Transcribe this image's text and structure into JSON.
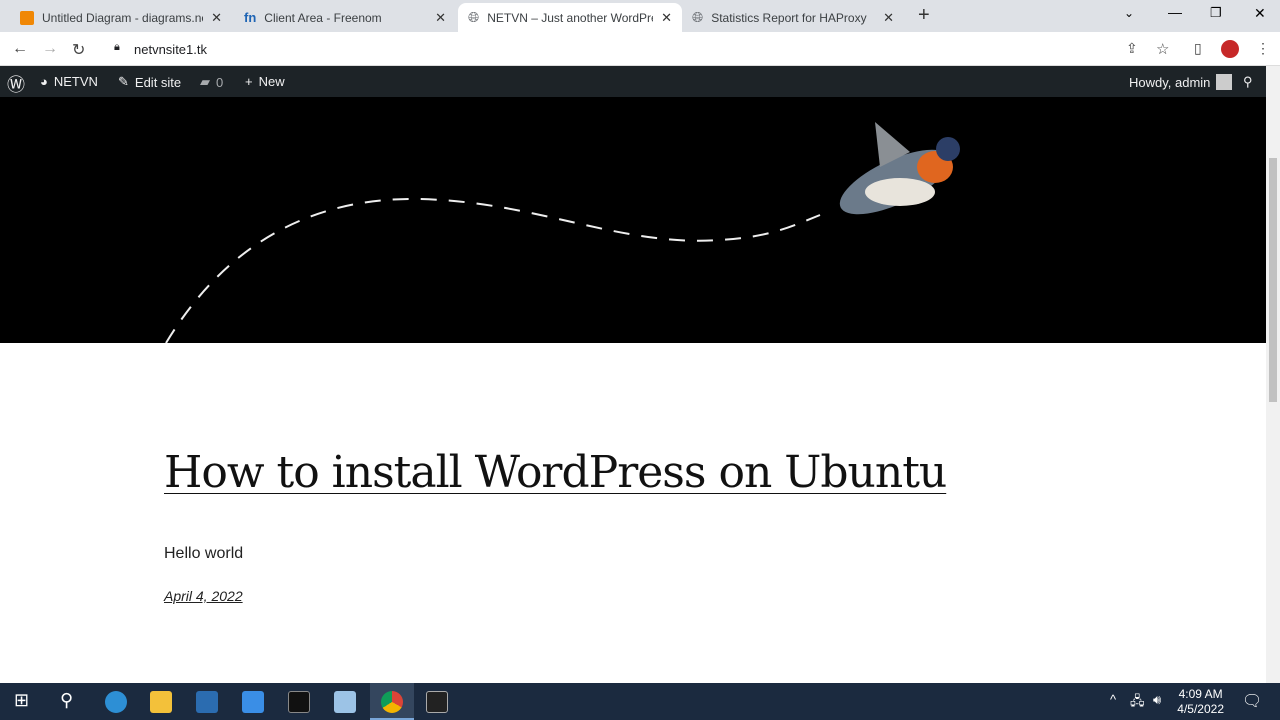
{
  "browser": {
    "tabs": [
      {
        "title": "Untitled Diagram - diagrams.net",
        "active": false,
        "favicon_color": "#f08705"
      },
      {
        "title": "Client Area - Freenom",
        "active": false,
        "favicon_color": "#1e64b4"
      },
      {
        "title": "NETVN – Just another WordPress",
        "active": true,
        "favicon_color": "#5f6368"
      },
      {
        "title": "Statistics Report for HAProxy",
        "active": false,
        "favicon_color": "#5f6368"
      }
    ],
    "new_tab": "+",
    "url": "netvnsite1.tk"
  },
  "wp_admin_bar": {
    "site": "NETVN",
    "edit": "Edit site",
    "comments": "0",
    "new": "New",
    "howdy": "Howdy, admin"
  },
  "post": {
    "title": "How to install WordPress on Ubuntu",
    "excerpt": "Hello world",
    "date": "April 4, 2022"
  },
  "taskbar": {
    "time": "4:09 AM",
    "date": "4/5/2022"
  }
}
